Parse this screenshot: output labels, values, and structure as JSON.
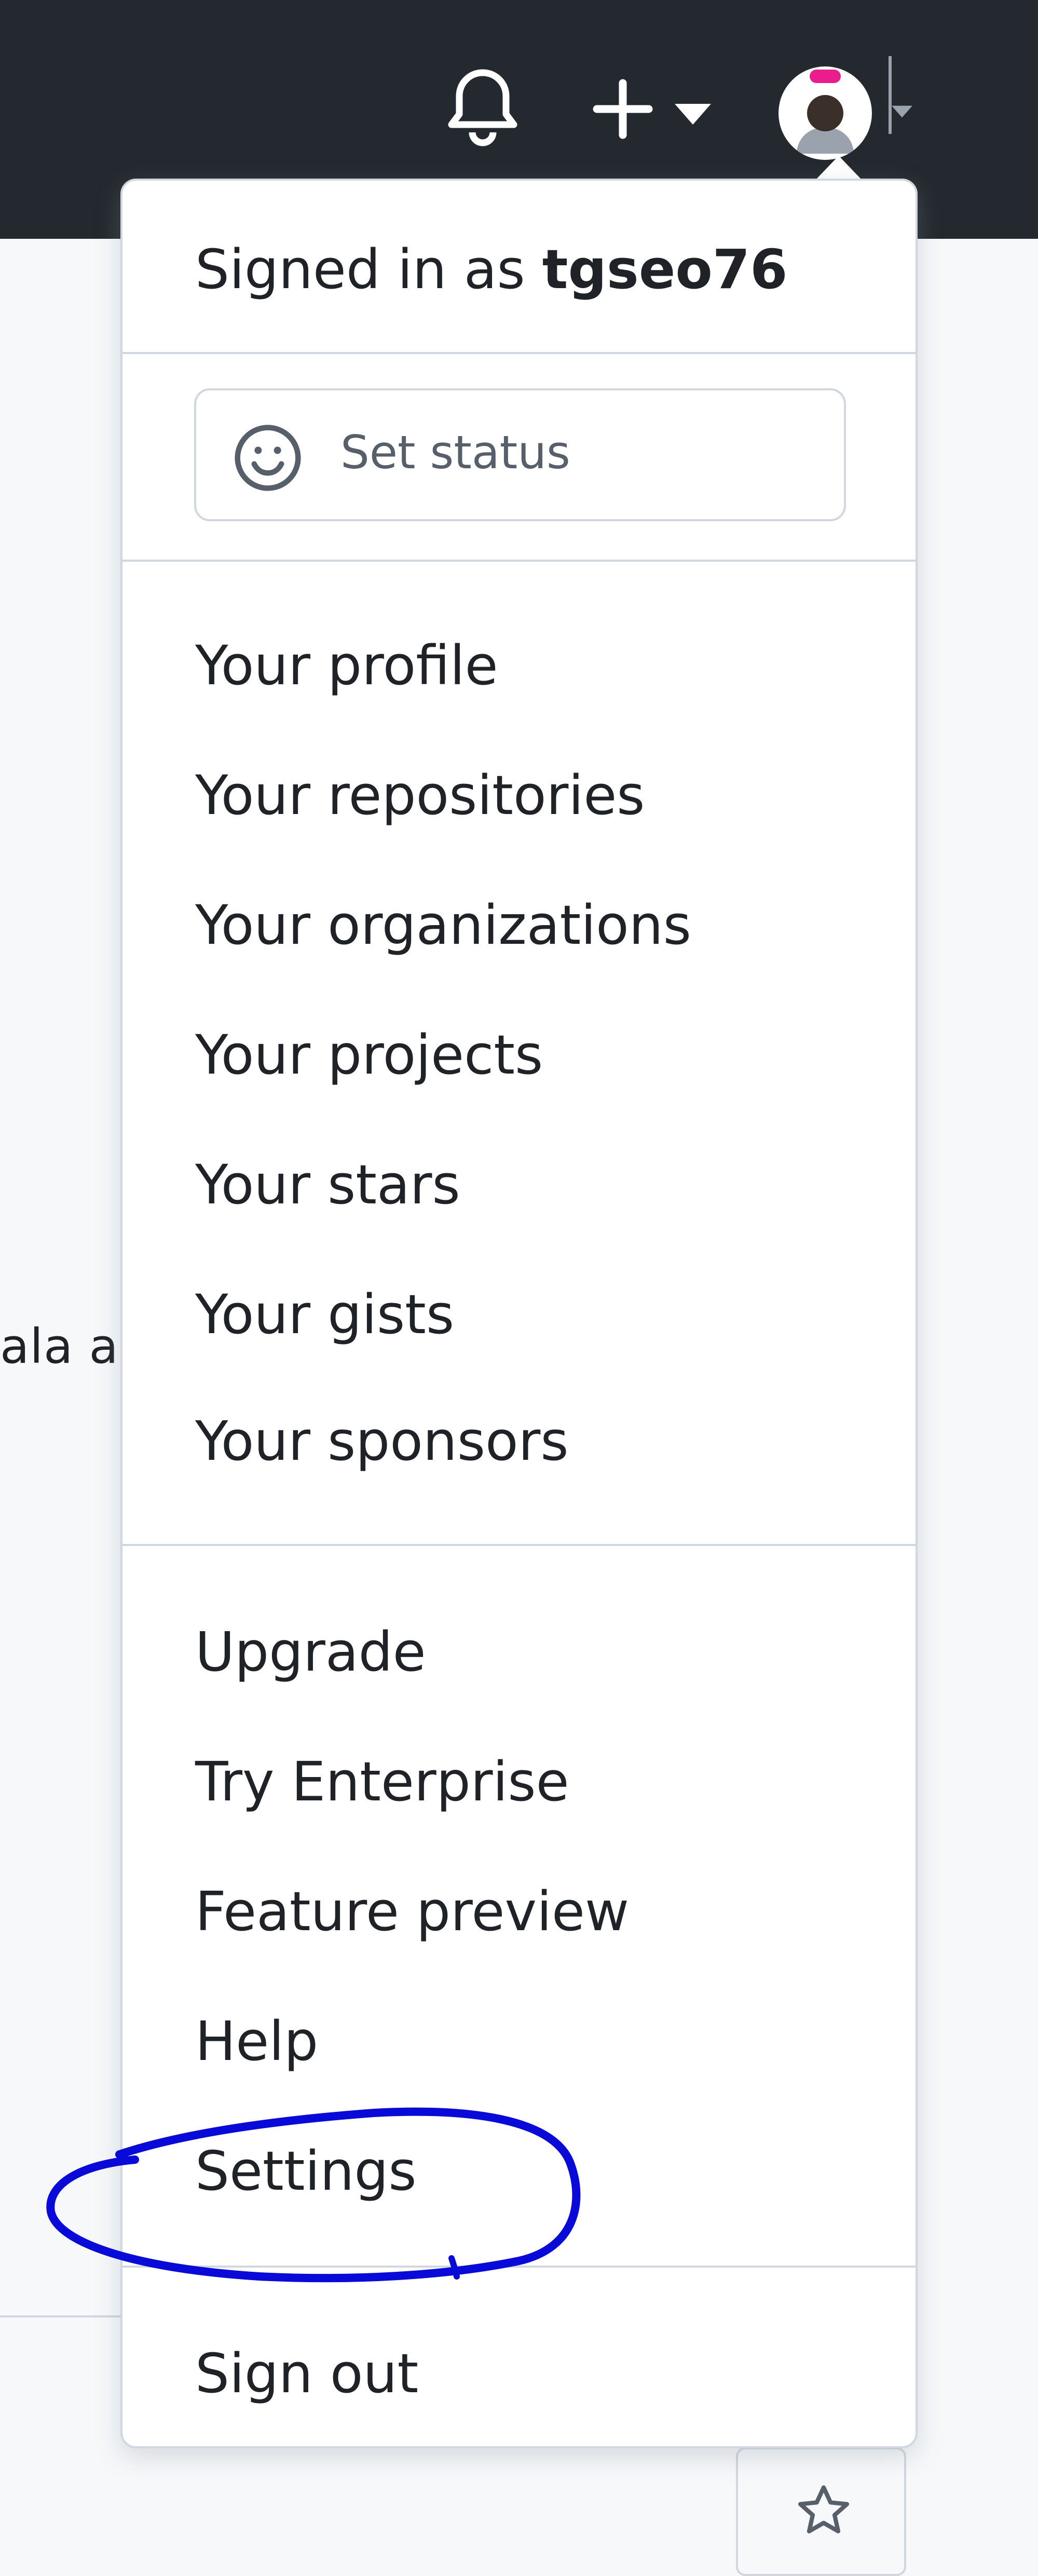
{
  "header": {
    "notifications_icon": "bell-icon",
    "create_icon": "plus-icon",
    "create_caret_icon": "caret-down-icon",
    "avatar_icon": "avatar",
    "colors": {
      "background": "#24292f",
      "icon": "#ffffff"
    }
  },
  "background": {
    "partial_text": "ala ar",
    "star_icon": "star-icon"
  },
  "menu": {
    "signed_in_prefix": "Signed in as",
    "username": "tgseo76",
    "set_status": {
      "icon": "smiley-icon",
      "label": "Set status"
    },
    "items_group1": [
      {
        "label": "Your profile"
      },
      {
        "label": "Your repositories"
      },
      {
        "label": "Your organizations"
      },
      {
        "label": "Your projects"
      },
      {
        "label": "Your stars"
      },
      {
        "label": "Your gists"
      },
      {
        "label": "Your sponsors"
      }
    ],
    "items_group2": [
      {
        "label": "Upgrade"
      },
      {
        "label": "Try Enterprise"
      },
      {
        "label": "Feature preview"
      },
      {
        "label": "Help"
      },
      {
        "label": "Settings"
      }
    ],
    "sign_out": "Sign out"
  },
  "annotation": {
    "color": "#0a0ad8",
    "highlighted_item": "Settings"
  }
}
